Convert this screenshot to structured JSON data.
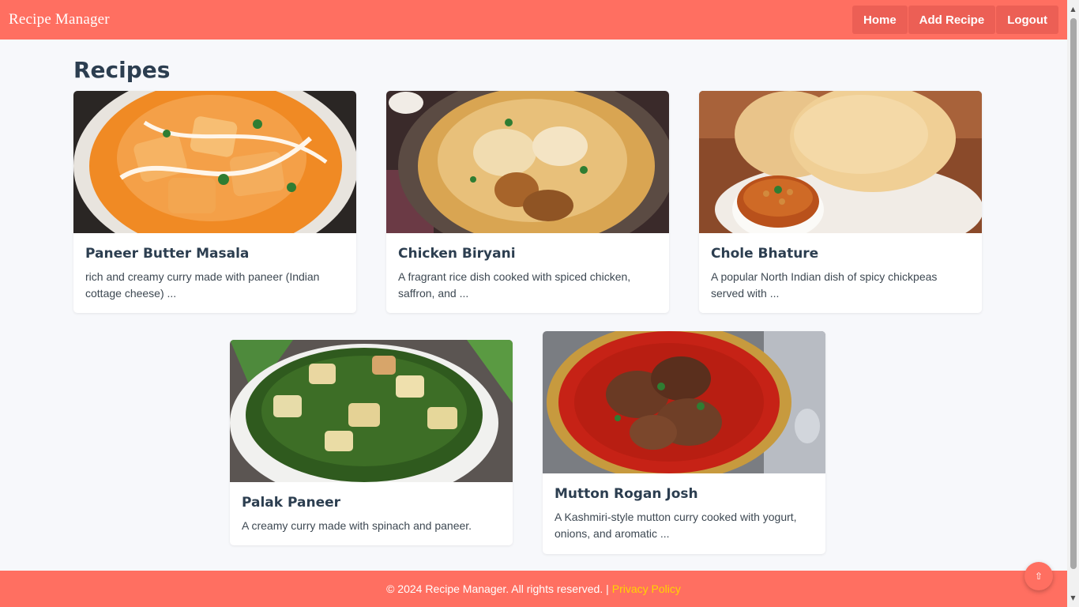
{
  "navbar": {
    "brand": "Recipe Manager",
    "links": [
      "Home",
      "Add Recipe",
      "Logout"
    ]
  },
  "page": {
    "title": "Recipes"
  },
  "recipes": [
    {
      "title": "Paneer Butter Masala",
      "description": "rich and creamy curry made with paneer (Indian cottage cheese) ..."
    },
    {
      "title": "Chicken Biryani",
      "description": "A fragrant rice dish cooked with spiced chicken, saffron, and ..."
    },
    {
      "title": "Chole Bhature",
      "description": "A popular North Indian dish of spicy chickpeas served with ..."
    },
    {
      "title": "Palak Paneer",
      "description": "A creamy curry made with spinach and paneer."
    },
    {
      "title": "Mutton Rogan Josh",
      "description": "A Kashmiri-style mutton curry cooked with yogurt, onions, and aromatic ..."
    }
  ],
  "footer": {
    "copyright": "© 2024 Recipe Manager. All rights reserved. |",
    "privacy_link": "Privacy Policy"
  },
  "scroll_top_icon": "arrow-up-icon",
  "colors": {
    "primary": "#ff6f61",
    "link": "#ffd400",
    "text": "#2c3e50",
    "background": "#f7f8fb"
  }
}
